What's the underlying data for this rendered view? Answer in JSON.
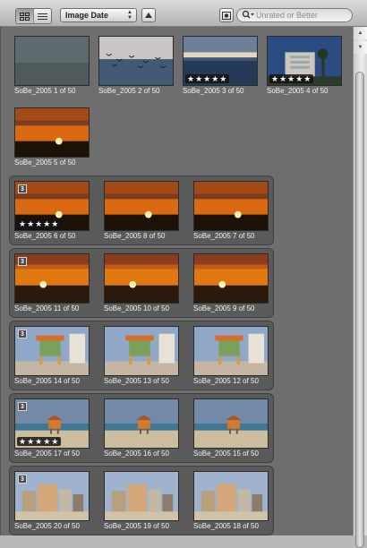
{
  "toolbar": {
    "sort_by": "Image Date",
    "search_placeholder": "Unrated or Better"
  },
  "icons": {
    "grid_view": "grid-view-icon",
    "list_view": "list-view-icon",
    "sort_direction": "sort-ascending-icon",
    "filter_menu": "filter-menu-icon",
    "search": "search-icon"
  },
  "thumbnails": {
    "t1": {
      "caption": "SoBe_2005 1 of 50",
      "scene": "dusk"
    },
    "t2": {
      "caption": "SoBe_2005 2 of 50",
      "scene": "birds"
    },
    "t3": {
      "caption": "SoBe_2005 3 of 50",
      "scene": "sunset-sea",
      "rating": "★★★★★"
    },
    "t4": {
      "caption": "SoBe_2005 4 of 50",
      "scene": "hotel",
      "rating": "★★★★★"
    },
    "t5": {
      "caption": "SoBe_2005 5 of 50",
      "scene": "orange-sunset"
    },
    "t6": {
      "caption": "SoBe_2005 6 of 50",
      "scene": "orange-sunset",
      "rating": "★★★★★",
      "badge": "3"
    },
    "t8": {
      "caption": "SoBe_2005 8 of 50",
      "scene": "orange-sunset"
    },
    "t7": {
      "caption": "SoBe_2005 7 of 50",
      "scene": "orange-sunset"
    },
    "t11": {
      "caption": "SoBe_2005 11 of 50",
      "scene": "sunrise",
      "badge": "3"
    },
    "t10": {
      "caption": "SoBe_2005 10 of 50",
      "scene": "sunrise"
    },
    "t9": {
      "caption": "SoBe_2005 9 of 50",
      "scene": "sunrise"
    },
    "t14": {
      "caption": "SoBe_2005 14 of 50",
      "scene": "lifeguard-stand",
      "badge": "3"
    },
    "t13": {
      "caption": "SoBe_2005 13 of 50",
      "scene": "lifeguard-stand"
    },
    "t12": {
      "caption": "SoBe_2005 12 of 50",
      "scene": "lifeguard-stand"
    },
    "t17": {
      "caption": "SoBe_2005 17 of 50",
      "scene": "beach-hut",
      "rating": "★★★★★",
      "badge": "3"
    },
    "t16": {
      "caption": "SoBe_2005 16 of 50",
      "scene": "beach-hut"
    },
    "t15": {
      "caption": "SoBe_2005 15 of 50",
      "scene": "beach-hut"
    },
    "t20": {
      "caption": "SoBe_2005 20 of 50",
      "scene": "buildings",
      "badge": "3"
    },
    "t19": {
      "caption": "SoBe_2005 19 of 50",
      "scene": "buildings"
    },
    "t18": {
      "caption": "SoBe_2005 18 of 50",
      "scene": "buildings"
    }
  }
}
